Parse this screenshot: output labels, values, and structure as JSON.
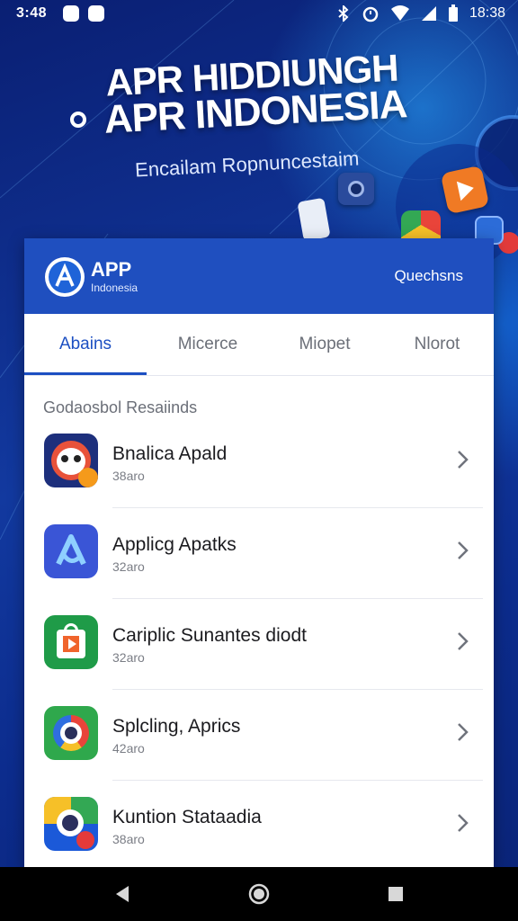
{
  "status_bar": {
    "time_left": "3:48",
    "clock": "18:38"
  },
  "hero": {
    "title_line1": "APR HIDDIUNGH",
    "title_line2": "APR INDONESIA",
    "subtitle": "Encailam Ropnuncestaim"
  },
  "card": {
    "brand_title": "APP",
    "brand_sub": "Indonesia",
    "header_link": "Quechsns",
    "tabs": [
      {
        "label": "Abains",
        "active": true
      },
      {
        "label": "Micerce",
        "active": false
      },
      {
        "label": "Miopet",
        "active": false
      },
      {
        "label": "Nlorot",
        "active": false
      }
    ],
    "section_label": "Godaosbol Resaiinds",
    "apps": [
      {
        "title": "Bnalica Apald",
        "size": "38aro",
        "icon": "panda-app-icon",
        "color": "#1d2f7c"
      },
      {
        "title": "Applicg Apatks",
        "size": "32aro",
        "icon": "blue-a-app-icon",
        "color": "#3a55d6"
      },
      {
        "title": "Cariplic Sunantes diodt",
        "size": "32aro",
        "icon": "green-bag-app-icon",
        "color": "#1f9b48"
      },
      {
        "title": "Splcling, Aprics",
        "size": "42aro",
        "icon": "ring-app-icon",
        "color": "#2fa84c"
      },
      {
        "title": "Kuntion Stataadia",
        "size": "38aro",
        "icon": "maps-app-icon",
        "color": "#1b59d8"
      }
    ]
  },
  "colors": {
    "accent": "#1c4fc2",
    "header": "#1f4fbf",
    "background": "#0b2a86"
  }
}
